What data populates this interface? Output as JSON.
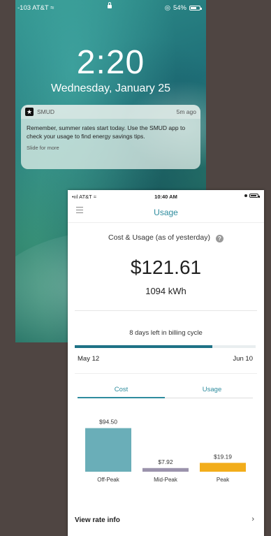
{
  "lock": {
    "carrier": "-103 AT&T",
    "battery": "54%",
    "time": "2:20",
    "date": "Wednesday, January 25",
    "notification": {
      "app": "SMUD",
      "ago": "5m ago",
      "body": "Remember, summer rates start today. Use the SMUD app to check your usage to find energy savings tips.",
      "slide": "Slide for more"
    }
  },
  "app": {
    "carrier": "AT&T",
    "time": "10:40 AM",
    "title": "Usage",
    "cost_label": "Cost & Usage (as of yesterday)",
    "amount": "$121.61",
    "kwh": "1094 kWh",
    "days_left": "8 days left in billing cycle",
    "progress": 0.76,
    "start": "May 12",
    "end": "Jun 10",
    "tabs": [
      "Cost",
      "Usage"
    ],
    "view_rate": "View rate info",
    "colors": {
      "accent": "#2e8c9e",
      "progress": "#1e7286"
    }
  },
  "chart_data": {
    "type": "bar",
    "categories": [
      "Off-Peak",
      "Mid-Peak",
      "Peak"
    ],
    "values": [
      94.5,
      7.92,
      19.19
    ],
    "labels": [
      "$94.50",
      "$7.92",
      "$19.19"
    ],
    "colors": [
      "#6aaeb8",
      "#9b93ac",
      "#f2ad1b"
    ],
    "ylim": [
      0,
      100
    ]
  }
}
